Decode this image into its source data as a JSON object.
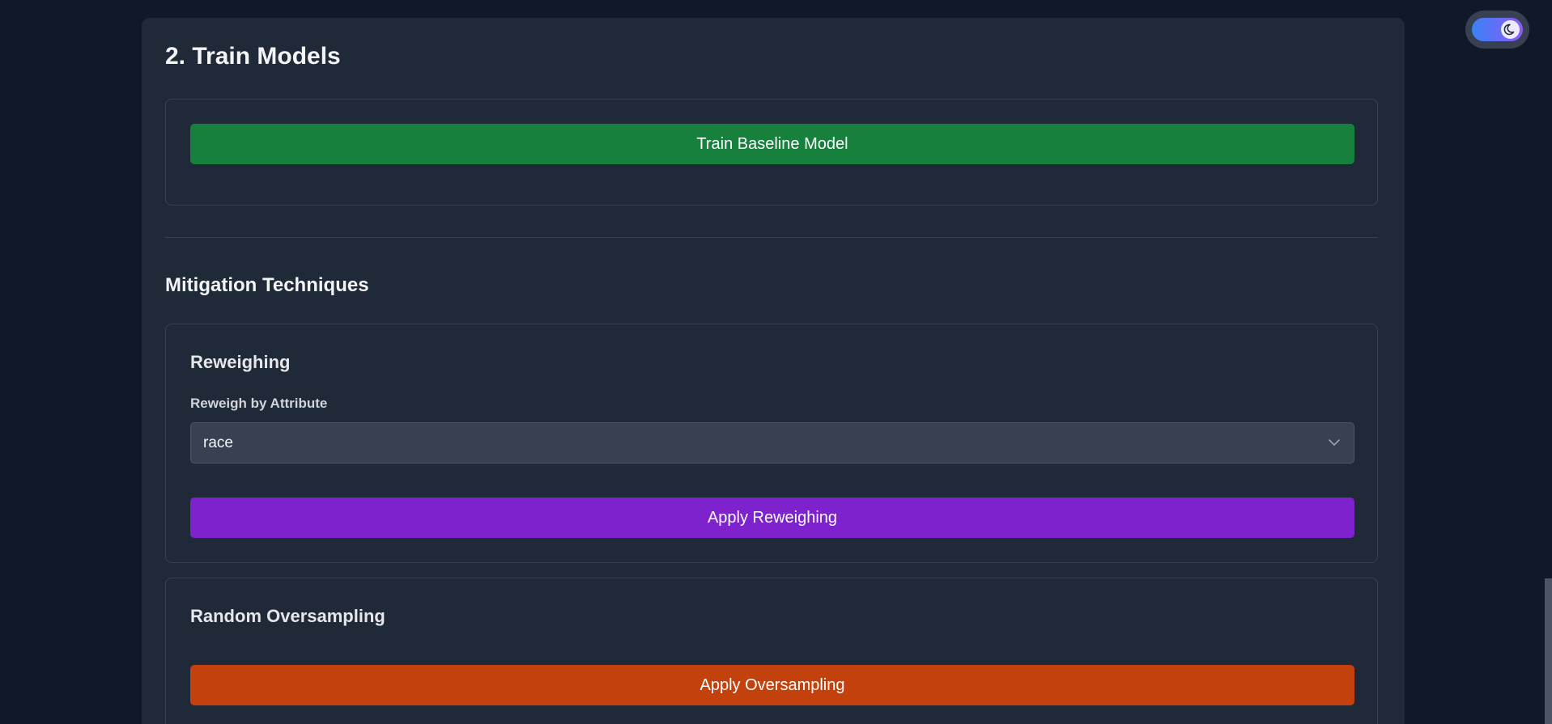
{
  "train_section": {
    "title": "2. Train Models",
    "baseline_button_label": "Train Baseline Model"
  },
  "mitigation": {
    "title": "Mitigation Techniques",
    "reweighing": {
      "heading": "Reweighing",
      "attribute_label": "Reweigh by Attribute",
      "attribute_value": "race",
      "apply_label": "Apply Reweighing"
    },
    "oversampling": {
      "heading": "Random Oversampling",
      "apply_label": "Apply Oversampling"
    }
  },
  "theme_toggle": {
    "icon": "moon-icon",
    "state": "dark"
  },
  "colors": {
    "background": "#111827",
    "card": "#1f2937",
    "train_button": "#16803c",
    "reweigh_button": "#7e22ce",
    "oversample_button": "#c2410c"
  }
}
